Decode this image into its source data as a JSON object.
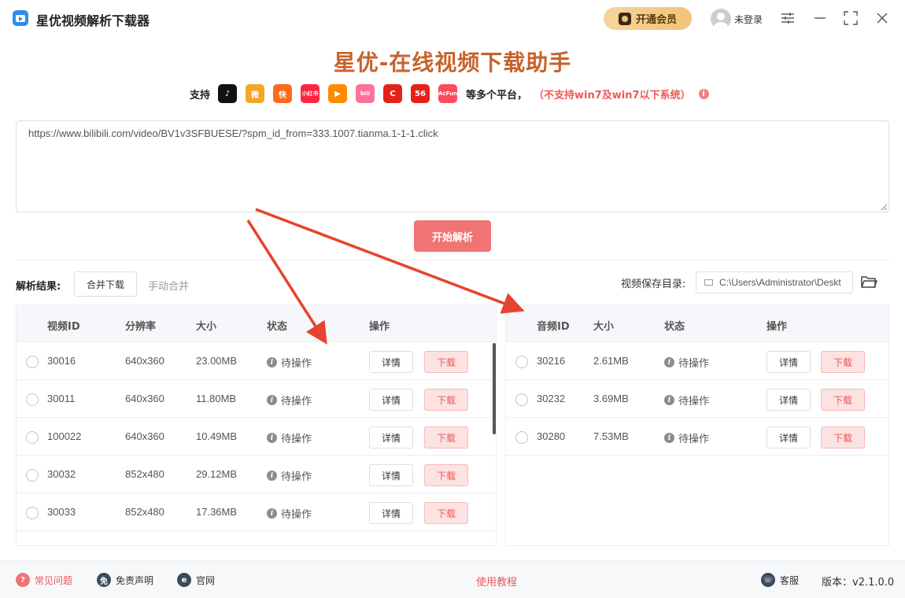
{
  "window": {
    "title": "星优视频解析下载器",
    "vip_label": "开通会员",
    "login_label": "未登录"
  },
  "header": {
    "title": "星优-在线视频下载助手",
    "support_label": "支持",
    "multi_label": "等多个平台，",
    "warning": "（不支持win7及win7以下系统）",
    "platforms": [
      {
        "name": "douyin-icon",
        "text": "♪",
        "color": "#111111"
      },
      {
        "name": "weibo-icon",
        "text": "微",
        "color": "#f5a623"
      },
      {
        "name": "kuaishou-icon",
        "text": "快",
        "color": "#ff6a1a"
      },
      {
        "name": "xiaohongshu-icon",
        "text": "小红书",
        "color": "#ff2442"
      },
      {
        "name": "tencent-video-icon",
        "text": "▶",
        "color": "#ff8a00"
      },
      {
        "name": "bilibili-icon",
        "text": "bili",
        "color": "#fb7299"
      },
      {
        "name": "iqiyi-icon",
        "text": "C",
        "color": "#e62117"
      },
      {
        "name": "56-icon",
        "text": "56",
        "color": "#e62117"
      },
      {
        "name": "acfun-icon",
        "text": "AcFun",
        "color": "#fd4c5d"
      }
    ]
  },
  "url_input": {
    "value": "https://www.bilibili.com/video/BV1v3SFBUESE/?spm_id_from=333.1007.tianma.1-1-1.click"
  },
  "parse_button": "开始解析",
  "results": {
    "label": "解析结果:",
    "merge_button": "合并下载",
    "manual_merge": "手动合并",
    "save_dir_label": "视频保存目录:",
    "save_dir_value": "C:\\Users\\Administrator\\Deskt"
  },
  "video_table": {
    "headers": {
      "id": "视频ID",
      "resolution": "分辨率",
      "size": "大小",
      "status": "状态",
      "action": "操作"
    },
    "rows": [
      {
        "id": "30016",
        "resolution": "640x360",
        "size": "23.00MB",
        "status": "待操作",
        "detail": "详情",
        "download": "下载"
      },
      {
        "id": "30011",
        "resolution": "640x360",
        "size": "11.80MB",
        "status": "待操作",
        "detail": "详情",
        "download": "下载"
      },
      {
        "id": "100022",
        "resolution": "640x360",
        "size": "10.49MB",
        "status": "待操作",
        "detail": "详情",
        "download": "下载"
      },
      {
        "id": "30032",
        "resolution": "852x480",
        "size": "29.12MB",
        "status": "待操作",
        "detail": "详情",
        "download": "下载"
      },
      {
        "id": "30033",
        "resolution": "852x480",
        "size": "17.36MB",
        "status": "待操作",
        "detail": "详情",
        "download": "下载"
      }
    ]
  },
  "audio_table": {
    "headers": {
      "id": "音频ID",
      "size": "大小",
      "status": "状态",
      "action": "操作"
    },
    "rows": [
      {
        "id": "30216",
        "size": "2.61MB",
        "status": "待操作",
        "detail": "详情",
        "download": "下载"
      },
      {
        "id": "30232",
        "size": "3.69MB",
        "status": "待操作",
        "detail": "详情",
        "download": "下载"
      },
      {
        "id": "30280",
        "size": "7.53MB",
        "status": "待操作",
        "detail": "详情",
        "download": "下载"
      }
    ]
  },
  "footer": {
    "faq": "常见问题",
    "disclaimer": "免责声明",
    "website": "官网",
    "tutorial": "使用教程",
    "service": "客服",
    "version": "版本：v2.1.0.0"
  },
  "colors": {
    "accent": "#f07474",
    "title": "#c8622c",
    "arrow": "#e8432e",
    "warning": "#f05656"
  }
}
